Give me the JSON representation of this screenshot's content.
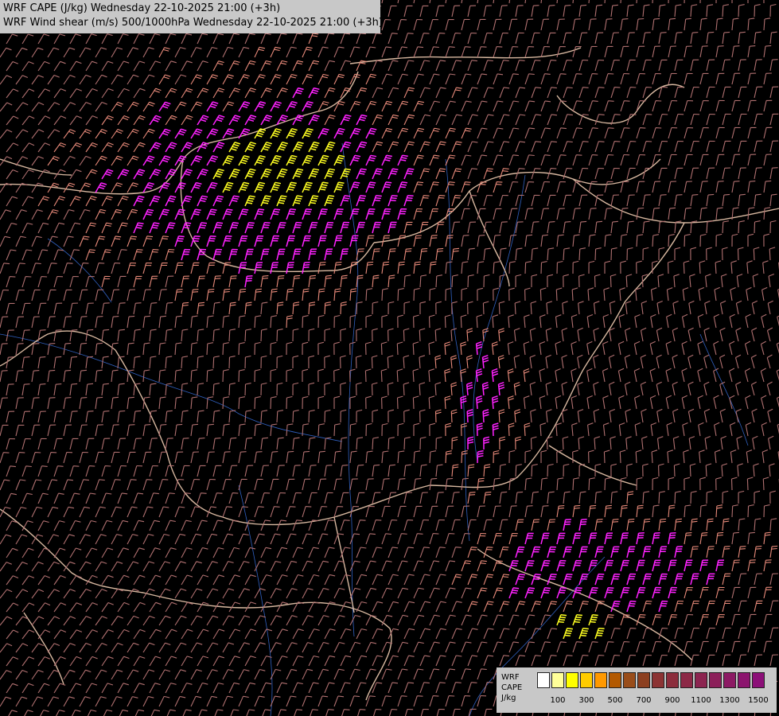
{
  "titles": {
    "line1": "WRF CAPE (J/kg) Wednesday 22-10-2025 21:00 (+3h)",
    "line2": "WRF Wind shear (m/s) 500/1000hPa Wednesday 22-10-2025 21:00 (+3h)"
  },
  "legend": {
    "model": "WRF",
    "field": "CAPE",
    "unit": "J/kg",
    "colors": [
      "#ffffff",
      "#ffff99",
      "#ffff00",
      "#ffcc00",
      "#ff9900",
      "#b35900",
      "#994d1a",
      "#8c3f1f",
      "#8c3333",
      "#8c2d3c",
      "#8c2846",
      "#8c2450",
      "#8c1f5a",
      "#8c1a64",
      "#8c146e",
      "#8c0f78"
    ],
    "tick_labels": [
      {
        "label": "100",
        "index": 1
      },
      {
        "label": "300",
        "index": 3
      },
      {
        "label": "500",
        "index": 5
      },
      {
        "label": "700",
        "index": 7
      },
      {
        "label": "900",
        "index": 9
      },
      {
        "label": "1100",
        "index": 11
      },
      {
        "label": "1300",
        "index": 13
      },
      {
        "label": "1500",
        "index": 15
      }
    ]
  },
  "barb_colors": {
    "weak": "#b07070",
    "moderate": "#e88a7a",
    "strong": "#ff22ff",
    "very_strong": "#ffff22"
  },
  "map_colors": {
    "background": "#000000",
    "border": "#d8b8a0",
    "river": "#3060c0"
  }
}
